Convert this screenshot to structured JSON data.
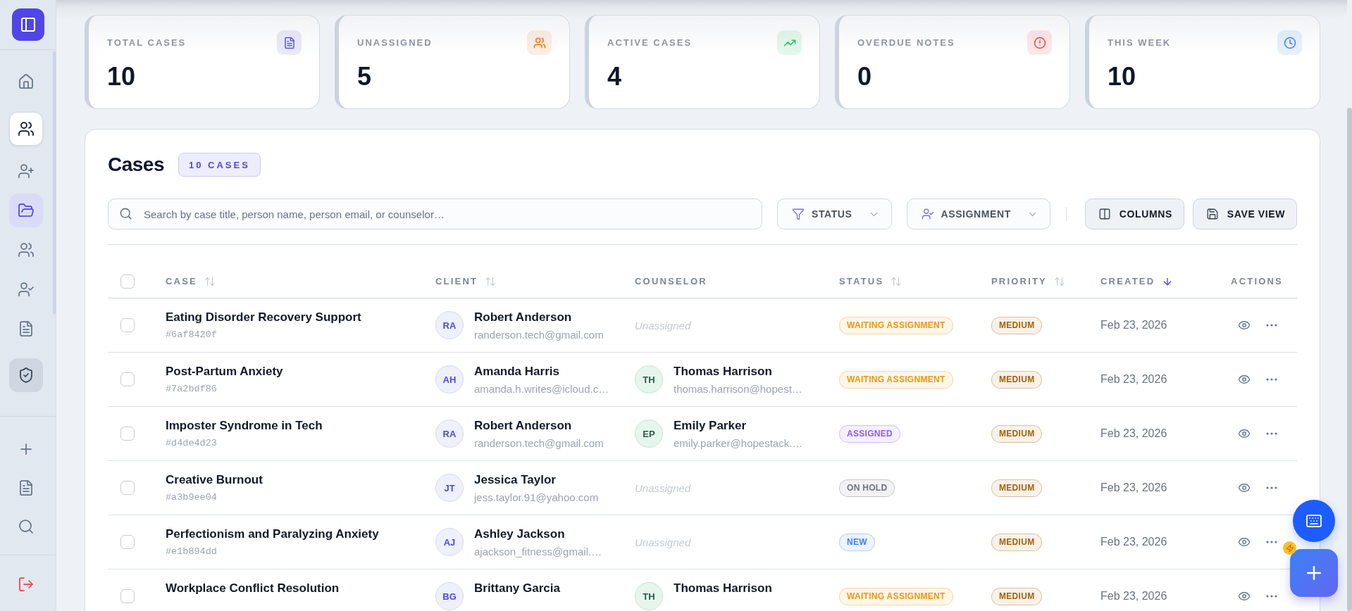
{
  "sidebar": {
    "nav_items": [
      {
        "selected": false,
        "highlighted": false,
        "hovered": false
      },
      {
        "selected": true,
        "highlighted": false,
        "hovered": false
      },
      {
        "selected": false,
        "highlighted": false,
        "hovered": false
      },
      {
        "selected": false,
        "highlighted": true,
        "hovered": false
      },
      {
        "selected": false,
        "highlighted": false,
        "hovered": false
      },
      {
        "selected": false,
        "highlighted": false,
        "hovered": false
      },
      {
        "selected": false,
        "highlighted": false,
        "hovered": false
      },
      {
        "selected": false,
        "highlighted": false,
        "hovered": true
      }
    ],
    "tool_items": [
      {
        "selected": false
      },
      {
        "selected": false
      },
      {
        "selected": false
      }
    ]
  },
  "stats": [
    {
      "label": "TOTAL CASES",
      "value": "10",
      "color": "#5b55e0"
    },
    {
      "label": "UNASSIGNED",
      "value": "5",
      "color": "#f97316"
    },
    {
      "label": "ACTIVE CASES",
      "value": "4",
      "color": "#22c55e"
    },
    {
      "label": "OVERDUE NOTES",
      "value": "0",
      "color": "#ef4444"
    },
    {
      "label": "THIS WEEK",
      "value": "10",
      "color": "#3b82f6"
    }
  ],
  "cases": {
    "title": "Cases",
    "count_badge": "10 CASES",
    "search": {
      "placeholder": "Search by case title, person name, person email, or counselor…"
    },
    "filters": [
      {
        "label": "STATUS"
      },
      {
        "label": "ASSIGNMENT"
      }
    ],
    "buttons": [
      {
        "label": "COLUMNS"
      },
      {
        "label": "SAVE VIEW"
      }
    ],
    "table": {
      "select_all": {
        "checked": false
      },
      "columns": [
        {
          "label": "CASE",
          "sortable": true,
          "sorted": false
        },
        {
          "label": "CLIENT",
          "sortable": true,
          "sorted": false
        },
        {
          "label": "COUNSELOR",
          "sortable": false,
          "sorted": false
        },
        {
          "label": "STATUS",
          "sortable": true,
          "sorted": false
        },
        {
          "label": "PRIORITY",
          "sortable": true,
          "sorted": false
        },
        {
          "label": "CREATED",
          "sortable": true,
          "sorted": true
        },
        {
          "label": "ACTIONS",
          "sortable": false,
          "sorted": false
        }
      ],
      "rows": [
        {
          "checked": false,
          "title": "Eating Disorder Recovery Support",
          "id": "#6af8420f",
          "client": {
            "initials": "RA",
            "name": "Robert Anderson",
            "email": "randerson.tech@gmail.com"
          },
          "counselor": {
            "kind": "unassigned",
            "text": "Unassigned"
          },
          "status": {
            "label": "WAITING ASSIGNMENT",
            "color": "#f0960e"
          },
          "priority": {
            "label": "MEDIUM",
            "color": "#a16207"
          },
          "created": "Feb 23, 2026"
        },
        {
          "checked": false,
          "title": "Post-Partum Anxiety",
          "id": "#7a2bdf86",
          "client": {
            "initials": "AH",
            "name": "Amanda Harris",
            "email": "amanda.h.writes@icloud.c…"
          },
          "counselor": {
            "kind": "person",
            "initials": "TH",
            "name": "Thomas Harrison",
            "email": "thomas.harrison@hopest…"
          },
          "status": {
            "label": "WAITING ASSIGNMENT",
            "color": "#f0960e"
          },
          "priority": {
            "label": "MEDIUM",
            "color": "#a16207"
          },
          "created": "Feb 23, 2026"
        },
        {
          "checked": false,
          "title": "Imposter Syndrome in Tech",
          "id": "#d4de4d23",
          "client": {
            "initials": "RA",
            "name": "Robert Anderson",
            "email": "randerson.tech@gmail.com"
          },
          "counselor": {
            "kind": "person",
            "initials": "EP",
            "name": "Emily Parker",
            "email": "emily.parker@hopestack.…"
          },
          "status": {
            "label": "ASSIGNED",
            "color": "#8b5cf6"
          },
          "priority": {
            "label": "MEDIUM",
            "color": "#a16207"
          },
          "created": "Feb 23, 2026"
        },
        {
          "checked": false,
          "title": "Creative Burnout",
          "id": "#a3b9ee04",
          "client": {
            "initials": "JT",
            "name": "Jessica Taylor",
            "email": "jess.taylor.91@yahoo.com"
          },
          "counselor": {
            "kind": "unassigned",
            "text": "Unassigned"
          },
          "status": {
            "label": "ON HOLD",
            "color": "#6b7280"
          },
          "priority": {
            "label": "MEDIUM",
            "color": "#a16207"
          },
          "created": "Feb 23, 2026"
        },
        {
          "checked": false,
          "title": "Perfectionism and Paralyzing Anxiety",
          "id": "#e1b894dd",
          "client": {
            "initials": "AJ",
            "name": "Ashley Jackson",
            "email": "ajackson_fitness@gmail.…"
          },
          "counselor": {
            "kind": "unassigned",
            "text": "Unassigned"
          },
          "status": {
            "label": "NEW",
            "color": "#3b82f6"
          },
          "priority": {
            "label": "MEDIUM",
            "color": "#a16207"
          },
          "created": "Feb 23, 2026"
        },
        {
          "checked": false,
          "title": "Workplace Conflict Resolution",
          "client": {
            "initials": "BG",
            "name": "Brittany Garcia"
          },
          "counselor": {
            "kind": "person",
            "initials": "TH",
            "name": "Thomas Harrison"
          },
          "status": {
            "label": "WAITING ASSIGNMENT",
            "color": "#f0960e"
          },
          "priority": {
            "label": "MEDIUM",
            "color": "#a16207"
          },
          "created": "Feb 23, 2026"
        }
      ]
    }
  }
}
